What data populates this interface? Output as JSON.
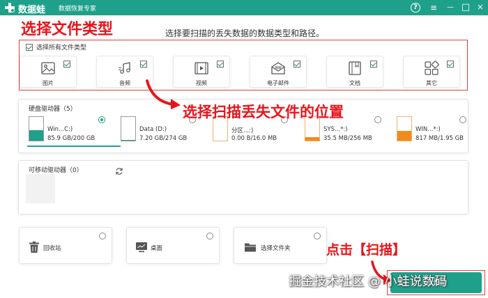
{
  "titlebar": {
    "app_name": "数据蛙",
    "app_sub": "数据恢复专家",
    "help": "?",
    "menu": "≡",
    "minimize": "—",
    "maximize": "□",
    "close": "✕"
  },
  "annotations": {
    "step1": "选择文件类型",
    "step2": "选择扫描丢失文件的位置",
    "step3": "点击【扫描】"
  },
  "instruction": "选择要扫描的丢失数据的数据类型和路径。",
  "select_all_label": "选择所有文件类型",
  "file_types": [
    {
      "label": "图片",
      "icon": "image-icon",
      "checked": true
    },
    {
      "label": "音频",
      "icon": "music-icon",
      "checked": true
    },
    {
      "label": "视频",
      "icon": "video-icon",
      "checked": true
    },
    {
      "label": "电子邮件",
      "icon": "email-icon",
      "checked": true
    },
    {
      "label": "文档",
      "icon": "document-icon",
      "checked": true
    },
    {
      "label": "其它",
      "icon": "other-icon",
      "checked": true
    }
  ],
  "hdd": {
    "title": "硬盘驱动器（5）",
    "drives": [
      {
        "name": "Win...C:)",
        "size": "85.9 GB/200 GB",
        "fill_pct": 43,
        "fill_color": "#1fa08a",
        "selected": true
      },
      {
        "name": "Data (D:)",
        "size": "7.20 GB/274 GB",
        "fill_pct": 3,
        "fill_color": "#1fa08a",
        "selected": false
      },
      {
        "name": "分区...:)",
        "size": "0.00  B/16.0 MB",
        "fill_pct": 0,
        "fill_color": "#f08c1e",
        "selected": false
      },
      {
        "name": "SYS...*:)",
        "size": "35.5 MB/256 MB",
        "fill_pct": 14,
        "fill_color": "#f08c1e",
        "selected": false
      },
      {
        "name": "WIN...*:)",
        "size": "817 MB/1.95 GB",
        "fill_pct": 42,
        "fill_color": "#f08c1e",
        "selected": false
      }
    ]
  },
  "removable": {
    "title": "可移动驱动器（0）"
  },
  "locations": [
    {
      "label": "回收站",
      "icon": "trash-icon"
    },
    {
      "label": "桌面",
      "icon": "desktop-icon"
    },
    {
      "label": "选择文件夹",
      "icon": "folder-icon"
    }
  ],
  "scan_label": "扫描",
  "watermark": "掘金技术社区 @ 小蛙说数码",
  "colors": {
    "accent": "#1fa08a",
    "annotation": "#e8141b",
    "partition": "#f08c1e"
  }
}
